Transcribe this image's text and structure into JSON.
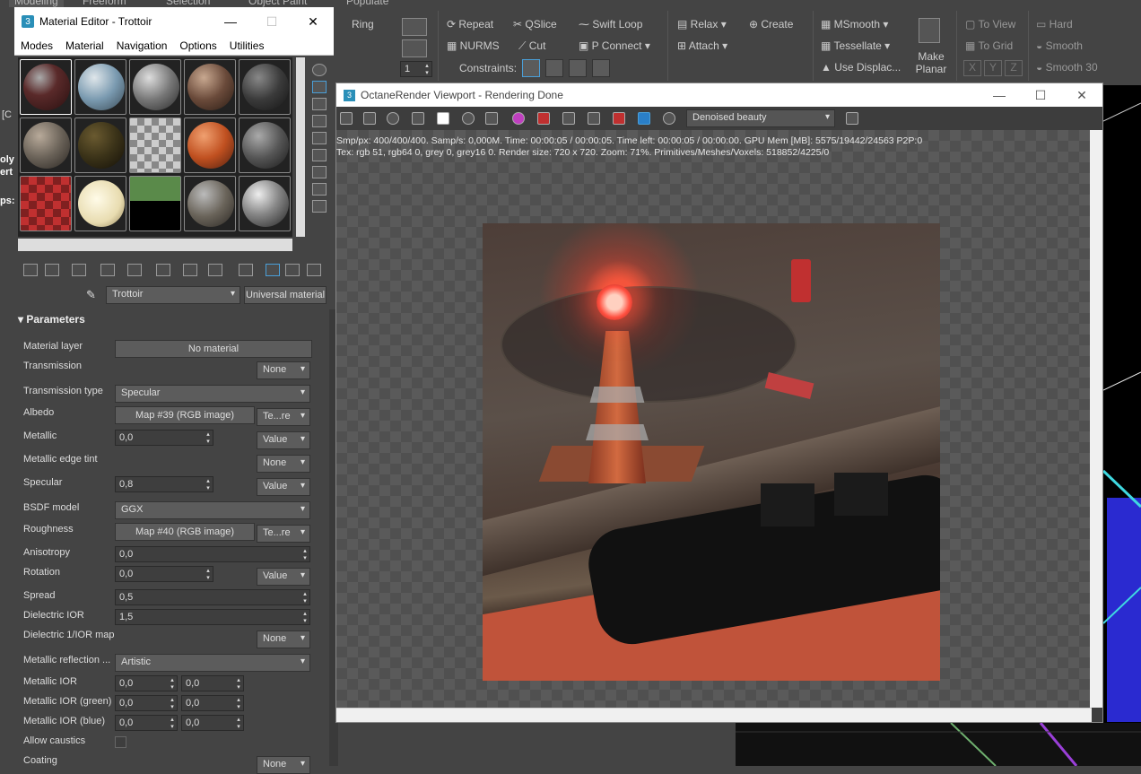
{
  "ribbon": {
    "tabs": [
      "Modeling",
      "Freeform",
      "Selection",
      "Object Paint",
      "Populate"
    ],
    "ring_label": "Ring",
    "repeat_label": "Repeat",
    "qslice_label": "QSlice",
    "swift_loop_label": "Swift Loop",
    "nurms_label": "NURMS",
    "cut_label": "Cut",
    "p_connect_label": "P Connect",
    "constraints_label": "Constraints:",
    "relax_label": "Relax",
    "create_label": "Create",
    "attach_label": "Attach",
    "msmooth_label": "MSmooth",
    "tessellate_label": "Tessellate",
    "use_displace_label": "Use Displac...",
    "make_planar_label": "Make Planar",
    "to_view_label": "To View",
    "to_grid_label": "To Grid",
    "x_label": "X",
    "y_label": "Y",
    "z_label": "Z",
    "hard_label": "Hard",
    "smooth_label": "Smooth",
    "smooth30_label": "Smooth 30",
    "spinner_value": "1"
  },
  "viewport_side": {
    "label_c": "[C",
    "label_oly": "oly",
    "label_ert": "ert",
    "label_ps": "ps:"
  },
  "material_editor": {
    "title": "Material Editor - Trottoir",
    "menu": [
      "Modes",
      "Material",
      "Navigation",
      "Options",
      "Utilities"
    ],
    "material_name": "Trottoir",
    "material_type": "Universal material",
    "parameters_heading": "Parameters",
    "rows": {
      "material_layer": {
        "label": "Material layer",
        "value": "No material"
      },
      "transmission": {
        "label": "Transmission",
        "mode": "None"
      },
      "transmission_type": {
        "label": "Transmission type",
        "value": "Specular"
      },
      "albedo": {
        "label": "Albedo",
        "value": "Map #39 (RGB image)",
        "mode": "Te...re"
      },
      "metallic": {
        "label": "Metallic",
        "value": "0,0",
        "mode": "Value"
      },
      "metallic_edge_tint": {
        "label": "Metallic edge tint",
        "mode": "None"
      },
      "specular": {
        "label": "Specular",
        "value": "0,8",
        "mode": "Value"
      },
      "bsdf_model": {
        "label": "BSDF model",
        "value": "GGX"
      },
      "roughness": {
        "label": "Roughness",
        "value": "Map #40 (RGB image)",
        "mode": "Te...re"
      },
      "anisotropy": {
        "label": "Anisotropy",
        "value": "0,0"
      },
      "rotation": {
        "label": "Rotation",
        "value": "0,0",
        "mode": "Value"
      },
      "spread": {
        "label": "Spread",
        "value": "0,5"
      },
      "dielectric_ior": {
        "label": "Dielectric IOR",
        "value": "1,5"
      },
      "dielectric_map": {
        "label": "Dielectric 1/IOR map",
        "mode": "None"
      },
      "metallic_reflection": {
        "label": "Metallic reflection ...",
        "value": "Artistic"
      },
      "metallic_ior": {
        "label": "Metallic IOR",
        "value1": "0,0",
        "value2": "0,0"
      },
      "metallic_ior_green": {
        "label": "Metallic IOR (green)",
        "value1": "0,0",
        "value2": "0,0"
      },
      "metallic_ior_blue": {
        "label": "Metallic IOR (blue)",
        "value1": "0,0",
        "value2": "0,0"
      },
      "allow_caustics": {
        "label": "Allow caustics"
      },
      "coating": {
        "label": "Coating",
        "mode": "None"
      }
    }
  },
  "octane": {
    "title": "OctaneRender Viewport - Rendering Done",
    "pass_select": "Denoised beauty",
    "info_line1": "Smp/px: 400/400/400.   Samp/s: 0,000M.   Time: 00:00:05 / 00:00:05.   Time left: 00:00:05 / 00:00:00.   GPU Mem [MB]: 5575/19442/24563 P2P:0",
    "info_line2": "Tex: rgb 51, rgb64 0, grey 0, grey16 0.   Render size: 720 x 720.   Zoom: 71%.   Primitives/Meshes/Voxels: 518852/4225/0"
  },
  "colors": {
    "accent": "#2a8fb8",
    "ui_bg": "#444444",
    "render_red": "#c0533a"
  }
}
